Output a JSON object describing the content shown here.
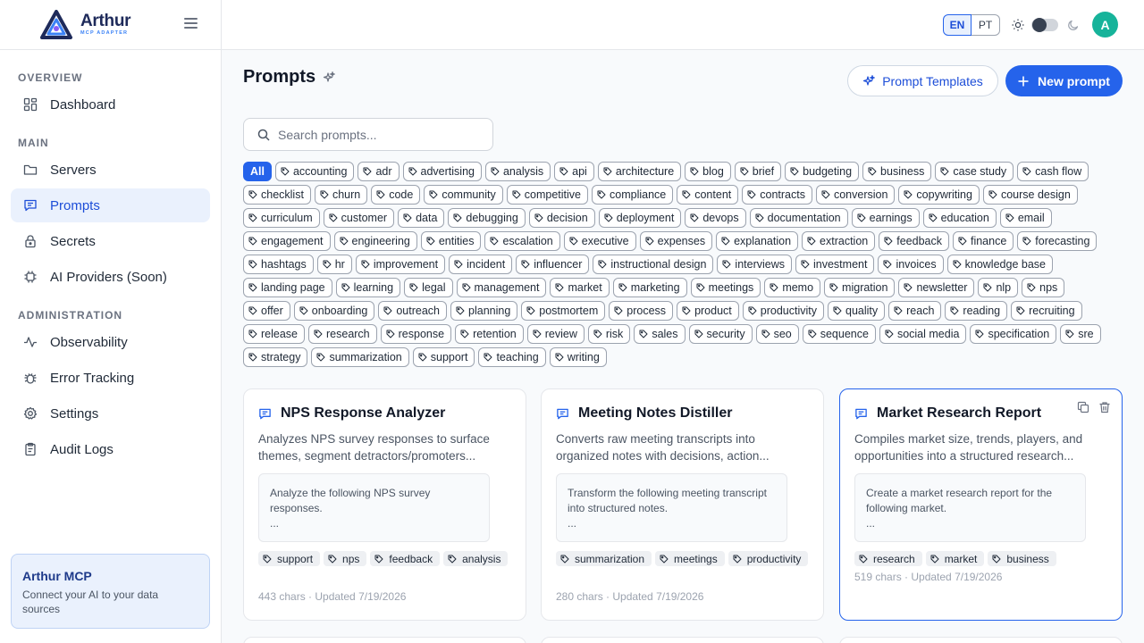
{
  "brand": {
    "name": "Arthur",
    "subtitle": "MCP ADAPTER"
  },
  "sidebar": {
    "sections": [
      {
        "label": "OVERVIEW"
      },
      {
        "label": "MAIN"
      },
      {
        "label": "ADMINISTRATION"
      }
    ],
    "items": [
      {
        "label": "Dashboard",
        "icon": "dashboard-icon"
      },
      {
        "label": "Servers",
        "icon": "folder-icon"
      },
      {
        "label": "Prompts",
        "icon": "message-icon",
        "active": true
      },
      {
        "label": "Secrets",
        "icon": "lock-icon"
      },
      {
        "label": "AI Providers (Soon)",
        "icon": "chip-icon"
      },
      {
        "label": "Observability",
        "icon": "activity-icon"
      },
      {
        "label": "Error Tracking",
        "icon": "bug-icon"
      },
      {
        "label": "Settings",
        "icon": "gear-icon"
      },
      {
        "label": "Audit Logs",
        "icon": "clipboard-icon"
      }
    ],
    "promo": {
      "title": "Arthur MCP",
      "text": "Connect your AI to your data sources"
    }
  },
  "topbar": {
    "lang": [
      "EN",
      "PT"
    ],
    "active_lang": "EN",
    "avatar": "A",
    "accent": "#2563eb",
    "avatar_color": "#16b39a"
  },
  "page": {
    "title": "Prompts",
    "templates_button": "Prompt Templates",
    "new_button": "New prompt",
    "search_placeholder": "Search prompts..."
  },
  "filter_all": "All",
  "tags": [
    "accounting",
    "adr",
    "advertising",
    "analysis",
    "api",
    "architecture",
    "blog",
    "brief",
    "budgeting",
    "business",
    "case study",
    "cash flow",
    "checklist",
    "churn",
    "code",
    "community",
    "competitive",
    "compliance",
    "content",
    "contracts",
    "conversion",
    "copywriting",
    "course design",
    "curriculum",
    "customer",
    "data",
    "debugging",
    "decision",
    "deployment",
    "devops",
    "documentation",
    "earnings",
    "education",
    "email",
    "engagement",
    "engineering",
    "entities",
    "escalation",
    "executive",
    "expenses",
    "explanation",
    "extraction",
    "feedback",
    "finance",
    "forecasting",
    "hashtags",
    "hr",
    "improvement",
    "incident",
    "influencer",
    "instructional design",
    "interviews",
    "investment",
    "invoices",
    "knowledge base",
    "landing page",
    "learning",
    "legal",
    "management",
    "market",
    "marketing",
    "meetings",
    "memo",
    "migration",
    "newsletter",
    "nlp",
    "nps",
    "offer",
    "onboarding",
    "outreach",
    "planning",
    "postmortem",
    "process",
    "product",
    "productivity",
    "quality",
    "reach",
    "reading",
    "recruiting",
    "release",
    "research",
    "response",
    "retention",
    "review",
    "risk",
    "sales",
    "security",
    "seo",
    "sequence",
    "social media",
    "specification",
    "sre",
    "strategy",
    "summarization",
    "support",
    "teaching",
    "writing"
  ],
  "cards": [
    {
      "title": "NPS Response Analyzer",
      "description": "Analyzes NPS survey responses to surface themes, segment detractors/promoters...",
      "preview": "Analyze the following NPS survey responses.",
      "preview_more": "...",
      "tags": [
        "support",
        "nps",
        "feedback",
        "analysis"
      ],
      "meta": "443 chars · Updated 7/19/2026"
    },
    {
      "title": "Meeting Notes Distiller",
      "description": "Converts raw meeting transcripts into organized notes with decisions, action...",
      "preview": "Transform the following meeting transcript into structured notes.",
      "preview_more": "...",
      "tags": [
        "summarization",
        "meetings",
        "productivity"
      ],
      "meta": "280 chars · Updated 7/19/2026"
    },
    {
      "title": "Market Research Report",
      "description": "Compiles market size, trends, players, and opportunities into a structured research...",
      "preview": "Create a market research report for the following market.",
      "preview_more": "...",
      "tags": [
        "research",
        "market",
        "business"
      ],
      "meta": "519 chars · Updated 7/19/2026"
    }
  ]
}
